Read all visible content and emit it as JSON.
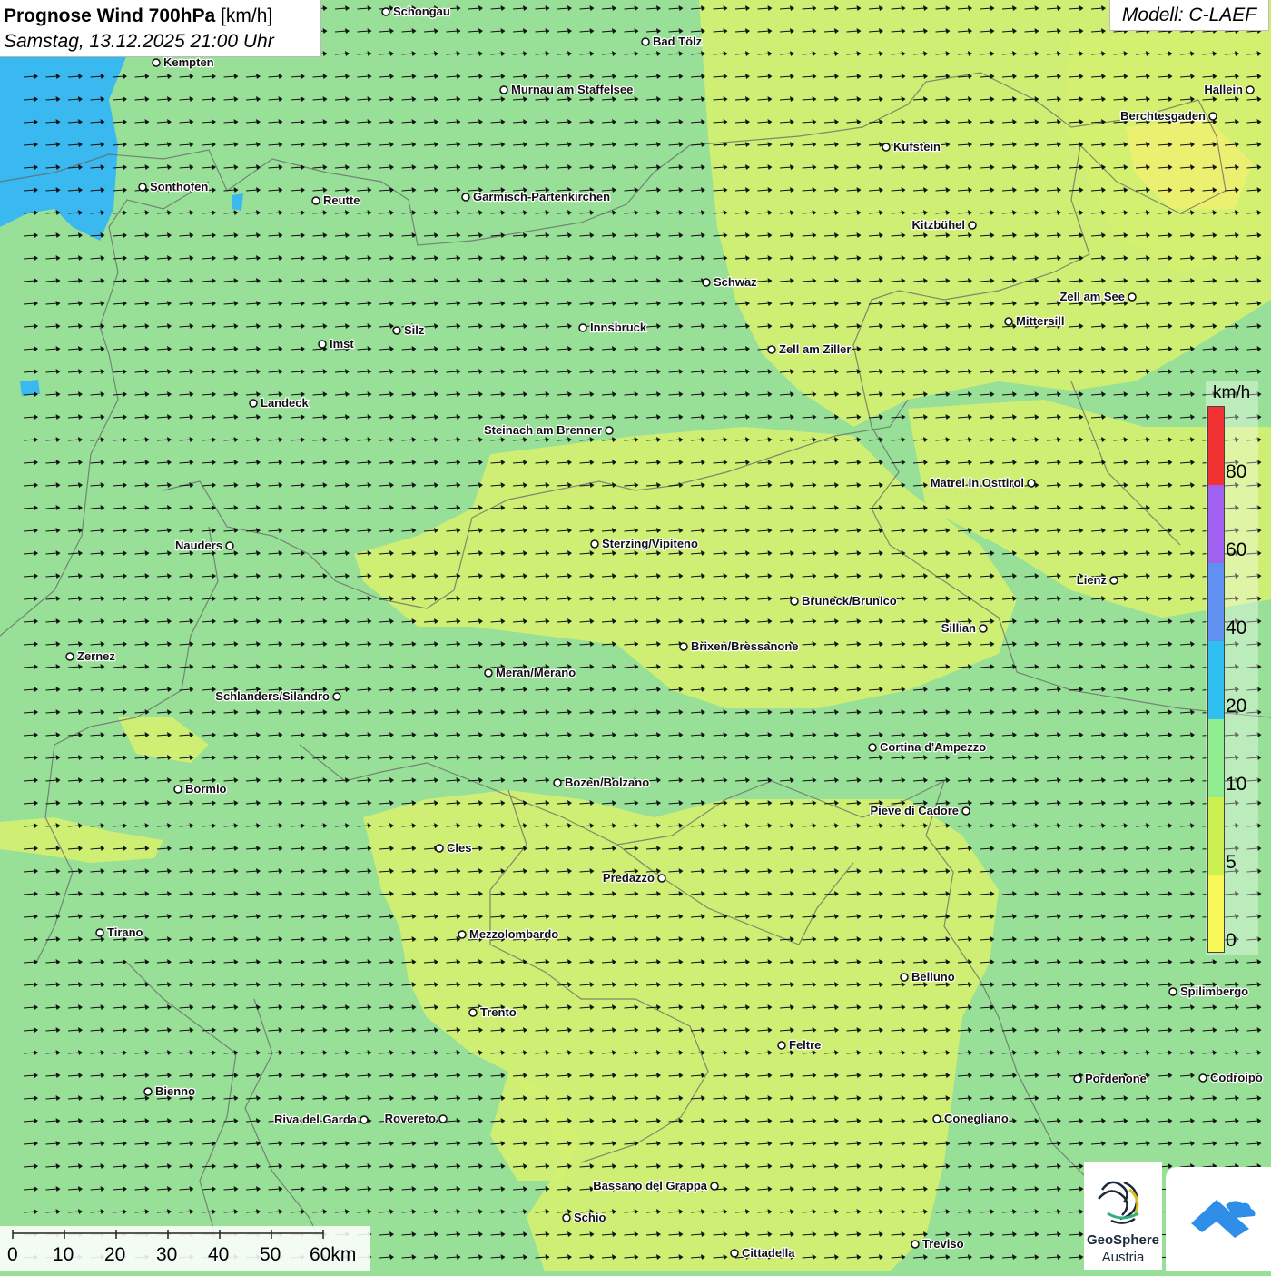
{
  "title": {
    "bold": "Prognose Wind 700hPa",
    "unit": "[km/h]",
    "datetime": "Samstag, 13.12.2025 21:00 Uhr"
  },
  "model": "Modell: C-LAEF",
  "legend": {
    "unit": "km/h",
    "ticks": [
      "80",
      "60",
      "40",
      "20",
      "10",
      "5",
      "0"
    ],
    "colors": [
      "#f03232",
      "#a060f0",
      "#6090f0",
      "#30c0f0",
      "#90ee90",
      "#ccf050",
      "#f8f858"
    ]
  },
  "scalebar": {
    "labels": [
      "0",
      "10",
      "20",
      "30",
      "40",
      "50",
      "60km"
    ]
  },
  "logo": {
    "line1": "GeoSphere",
    "line2": "Austria"
  },
  "map_colors": {
    "base": "#98e098",
    "calm": "#d4f070",
    "calm_strong": "#eef070",
    "water": "#3ab8f0",
    "border": "#666666"
  },
  "wind_arrow": {
    "direction": "east",
    "color": "#111111"
  },
  "cities": [
    {
      "name": "Schongau"
    },
    {
      "name": "Bad Tölz"
    },
    {
      "name": "Kempten"
    },
    {
      "name": "Murnau am Staffelsee"
    },
    {
      "name": "Hallein"
    },
    {
      "name": "Berchtesgaden"
    },
    {
      "name": "Kufstein"
    },
    {
      "name": "Sonthofen"
    },
    {
      "name": "Reutte"
    },
    {
      "name": "Garmisch-Partenkirchen"
    },
    {
      "name": "Kitzbühel"
    },
    {
      "name": "Schwaz"
    },
    {
      "name": "Zell am See"
    },
    {
      "name": "Mittersill"
    },
    {
      "name": "Silz"
    },
    {
      "name": "Innsbruck"
    },
    {
      "name": "Imst"
    },
    {
      "name": "Zell am Ziller"
    },
    {
      "name": "Landeck"
    },
    {
      "name": "Steinach am Brenner"
    },
    {
      "name": "Matrei in Osttirol"
    },
    {
      "name": "Nauders"
    },
    {
      "name": "Sterzing/Vipiteno"
    },
    {
      "name": "Lienz"
    },
    {
      "name": "Bruneck/Brunico"
    },
    {
      "name": "Sillian"
    },
    {
      "name": "Brixen/Bressanone"
    },
    {
      "name": "Zernez"
    },
    {
      "name": "Meran/Merano"
    },
    {
      "name": "Schlanders/Silandro"
    },
    {
      "name": "Cortina d'Ampezzo"
    },
    {
      "name": "Bozen/Bolzano"
    },
    {
      "name": "Bormio"
    },
    {
      "name": "Pieve di Cadore"
    },
    {
      "name": "Cles"
    },
    {
      "name": "Predazzo"
    },
    {
      "name": "Tirano"
    },
    {
      "name": "Mezzolombardo"
    },
    {
      "name": "Belluno"
    },
    {
      "name": "Spilimbergo"
    },
    {
      "name": "Trento"
    },
    {
      "name": "Feltre"
    },
    {
      "name": "Pordenone"
    },
    {
      "name": "Codroipo"
    },
    {
      "name": "Bienno"
    },
    {
      "name": "Riva del Garda"
    },
    {
      "name": "Rovereto"
    },
    {
      "name": "Conegliano"
    },
    {
      "name": "Bassano del Grappa"
    },
    {
      "name": "Schio"
    },
    {
      "name": "Treviso"
    },
    {
      "name": "Cittadella"
    }
  ]
}
